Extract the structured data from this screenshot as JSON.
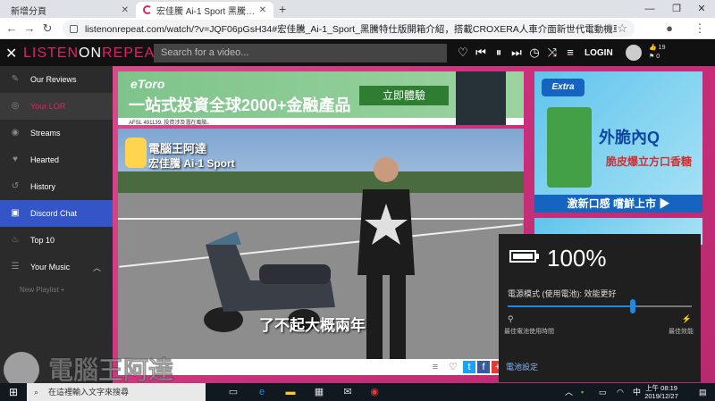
{
  "browser": {
    "tabs": [
      {
        "label": "新增分頁",
        "active": false
      },
      {
        "label": "宏佳騰 Ai-1 Sport 黑騰特仕版開箱介紹",
        "active": true
      }
    ],
    "url": "listenonrepeat.com/watch/?v=JQF06pGsH34#宏佳騰_Ai-1_Sport_黑騰特仕版開箱介紹，搭載CROXERA人車介面新世代電動機車"
  },
  "site": {
    "logo_part1": "LISTEN",
    "logo_part2": "ON",
    "logo_part3": "REPEAT",
    "search_placeholder": "Search for a video...",
    "login": "LOGIN",
    "stat_top": "19",
    "stat_bottom": "0"
  },
  "sidebar": {
    "items": [
      {
        "label": "Our Reviews"
      },
      {
        "label": "Your LOR"
      },
      {
        "label": "Streams"
      },
      {
        "label": "Hearted"
      },
      {
        "label": "History"
      },
      {
        "label": "Discord Chat"
      },
      {
        "label": "Top 10"
      },
      {
        "label": "Your Music"
      }
    ],
    "new_playlist": "New Playlist +"
  },
  "ads": {
    "etoro_logo": "eToro",
    "etoro_headline": "一站式投資全球2000+金融產品",
    "etoro_button": "立即體驗",
    "etoro_fine": "AFSL 491139. 投資涉及潛在風險。",
    "extra_logo": "Extra",
    "extra_headline": "外脆內Q",
    "extra_sub": "脆皮爆立方口香糖",
    "extra_bar": "激新口感 嚐鮮上市 ▶"
  },
  "video": {
    "channel": "電腦王阿達",
    "title_overlay": "宏佳騰 Ai-1 Sport",
    "subtitle": "了不起大概兩年"
  },
  "battery": {
    "percent": "100%",
    "mode": "電源模式 (使用電池): 效能更好",
    "left_label": "最佳電池使用時間",
    "right_label": "最佳效能",
    "settings": "電池設定",
    "slider_level": 0.68
  },
  "taskbar": {
    "search_placeholder": "在這裡輸入文字來搜尋",
    "ime": "中",
    "time": "上午 08:19",
    "date": "2019/12/27"
  },
  "watermark": {
    "text": "電腦王阿達",
    "url": "http://www.kocpc.com.tw"
  }
}
